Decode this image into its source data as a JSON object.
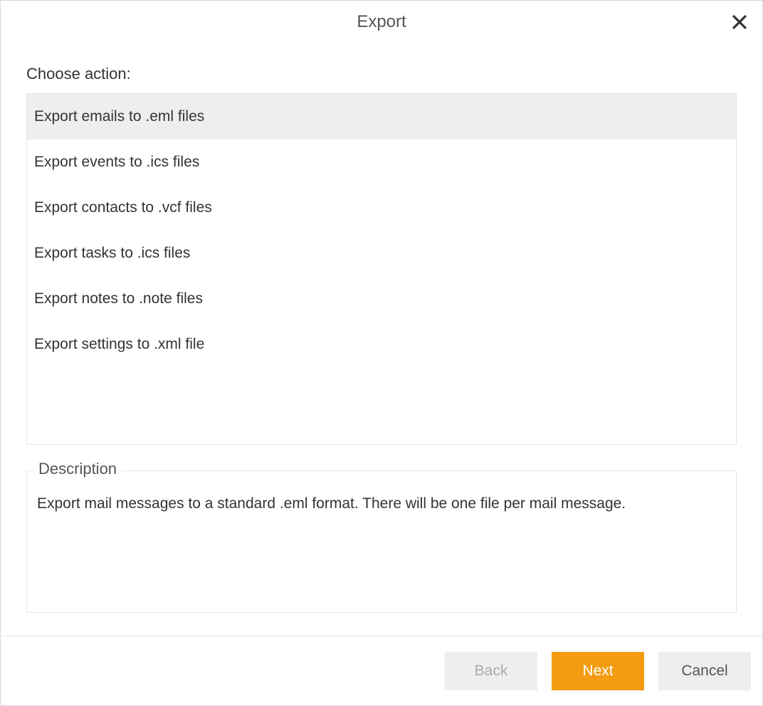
{
  "dialog": {
    "title": "Export",
    "choose_label": "Choose action:",
    "actions": [
      {
        "label": "Export emails to .eml files",
        "selected": true
      },
      {
        "label": "Export events to .ics files",
        "selected": false
      },
      {
        "label": "Export contacts to .vcf files",
        "selected": false
      },
      {
        "label": "Export tasks to .ics files",
        "selected": false
      },
      {
        "label": "Export notes to .note files",
        "selected": false
      },
      {
        "label": "Export settings to .xml file",
        "selected": false
      }
    ],
    "description": {
      "legend": "Description",
      "text": "Export mail messages to a standard .eml format. There will be one file per mail message."
    },
    "buttons": {
      "back": "Back",
      "next": "Next",
      "cancel": "Cancel"
    }
  }
}
